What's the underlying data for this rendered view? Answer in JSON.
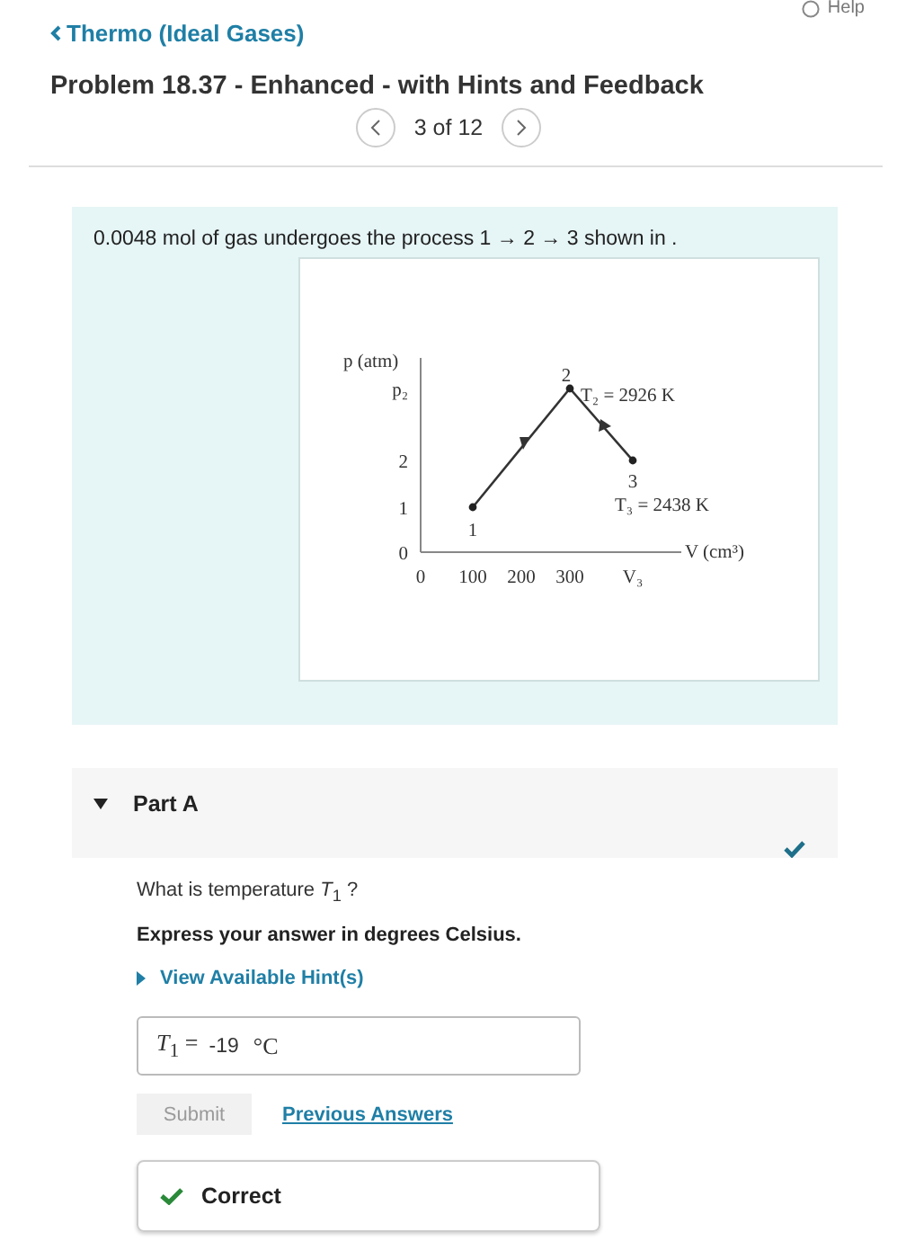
{
  "help": {
    "label": "Help"
  },
  "breadcrumb": {
    "label": "Thermo (Ideal Gases)"
  },
  "title": "Problem 18.37 - Enhanced - with Hints and Feedback",
  "pager": {
    "position": "3 of 12"
  },
  "problem": {
    "text": "0.0048 mol of gas undergoes the process 1 → 2 → 3 shown in .",
    "figure": {
      "y_axis_label": "p (atm)",
      "x_axis_label": "V (cm³)",
      "y_ticks": [
        "p₂",
        "2",
        "1",
        "0"
      ],
      "x_ticks": [
        "0",
        "100",
        "200",
        "300",
        "V₃"
      ],
      "point_labels": [
        "1",
        "2",
        "3"
      ],
      "temperature_labels": [
        "T₂ = 2926 K",
        "T₃ = 2438 K"
      ]
    }
  },
  "part": {
    "label": "Part A",
    "expanded": true,
    "completed": true,
    "question": "What is temperature *T*$_{1}$ ?",
    "instruction": "Express your answer in degrees Celsius.",
    "hint_link": "View Available Hint(s)",
    "answer": {
      "label": "*T*$_{1}$ =",
      "value": "-19",
      "unit": "°C"
    },
    "submit": {
      "label": "Submit",
      "disabled": true
    },
    "previous_answers": "Previous Answers",
    "feedback": {
      "label": "Correct",
      "correct": true
    }
  }
}
